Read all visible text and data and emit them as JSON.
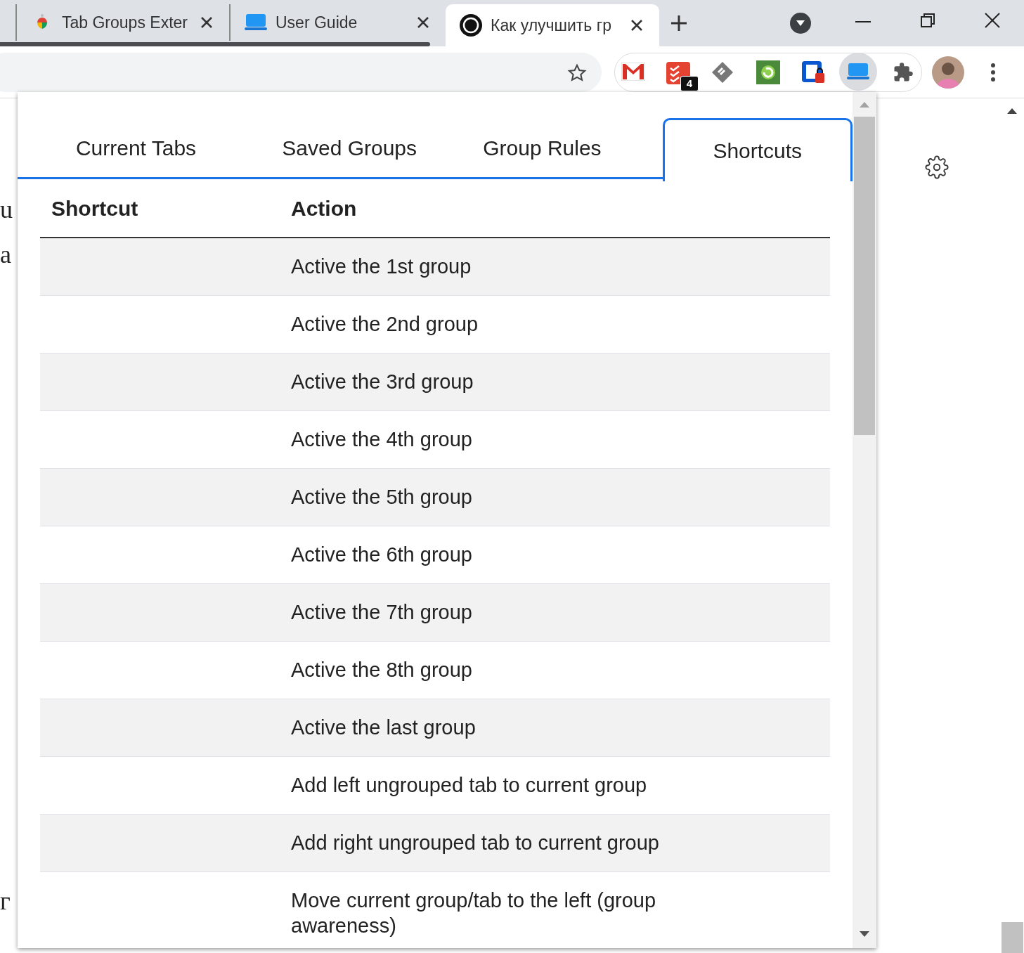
{
  "browser_tabs": [
    {
      "title": "Tab Groups Exter",
      "selected": false
    },
    {
      "title": "User Guide",
      "selected": false
    },
    {
      "title": "Как улучшить гр",
      "selected": true
    }
  ],
  "extension_badge": "4",
  "background_text": [
    "u",
    "a",
    "г"
  ],
  "popup": {
    "tabs": [
      {
        "label": "Current Tabs",
        "selected": false
      },
      {
        "label": "Saved Groups",
        "selected": false
      },
      {
        "label": "Group Rules",
        "selected": false
      },
      {
        "label": "Shortcuts",
        "selected": true
      }
    ],
    "table": {
      "columns": [
        "Shortcut",
        "Action"
      ],
      "rows": [
        {
          "action": "Active the 1st group"
        },
        {
          "action": "Active the 2nd group"
        },
        {
          "action": "Active the 3rd group"
        },
        {
          "action": "Active the 4th group"
        },
        {
          "action": "Active the 5th group"
        },
        {
          "action": "Active the 6th group"
        },
        {
          "action": "Active the 7th group"
        },
        {
          "action": "Active the 8th group"
        },
        {
          "action": "Active the last group"
        },
        {
          "action": "Add left ungrouped tab to current group"
        },
        {
          "action": "Add right ungrouped tab to current group"
        },
        {
          "action": "Move current group/tab to the left (group awareness)"
        }
      ]
    }
  }
}
